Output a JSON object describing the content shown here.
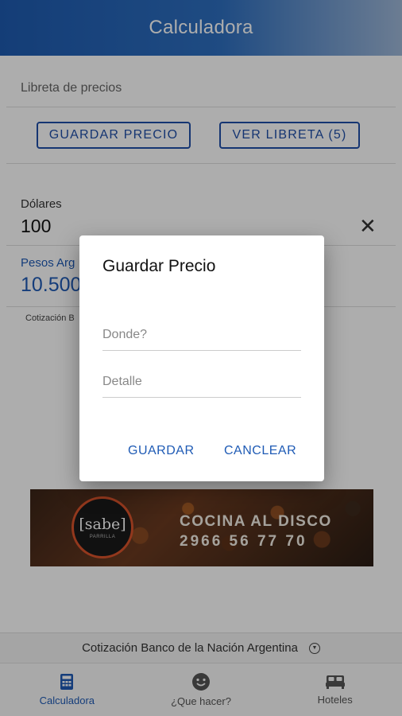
{
  "app_bar": {
    "title": "Calculadora"
  },
  "notebook": {
    "title": "Libreta de precios",
    "save_button": "GUARDAR PRECIO",
    "view_button": "VER LIBRETA (5)"
  },
  "dollars": {
    "label": "Dólares",
    "value": "100"
  },
  "pesos": {
    "label": "Pesos Arg",
    "value": "10.500"
  },
  "rate_note": "Cotización B",
  "banner": {
    "logo_text": "[sabe]",
    "logo_sub": "PARRILLA",
    "line1": "COCINA AL DISCO",
    "line2": "2966 56 77 70"
  },
  "footer": {
    "text": "Cotización Banco de la Nación Argentina",
    "icon": "chevron-down-circle-icon"
  },
  "bottom_nav": [
    {
      "label": "Calculadora",
      "icon": "calculator-icon",
      "active": true
    },
    {
      "label": "¿Que hacer?",
      "icon": "smiley-icon",
      "active": false
    },
    {
      "label": "Hoteles",
      "icon": "bed-icon",
      "active": false
    }
  ],
  "dialog": {
    "title": "Guardar Precio",
    "where_placeholder": "Donde?",
    "detail_placeholder": "Detalle",
    "save_action": "GUARDAR",
    "cancel_action": "CANCLEAR"
  },
  "colors": {
    "primary": "#1f5bb5",
    "app_bar": "#1e5bb0",
    "overlay": "rgba(0,0,0,0.32)"
  }
}
